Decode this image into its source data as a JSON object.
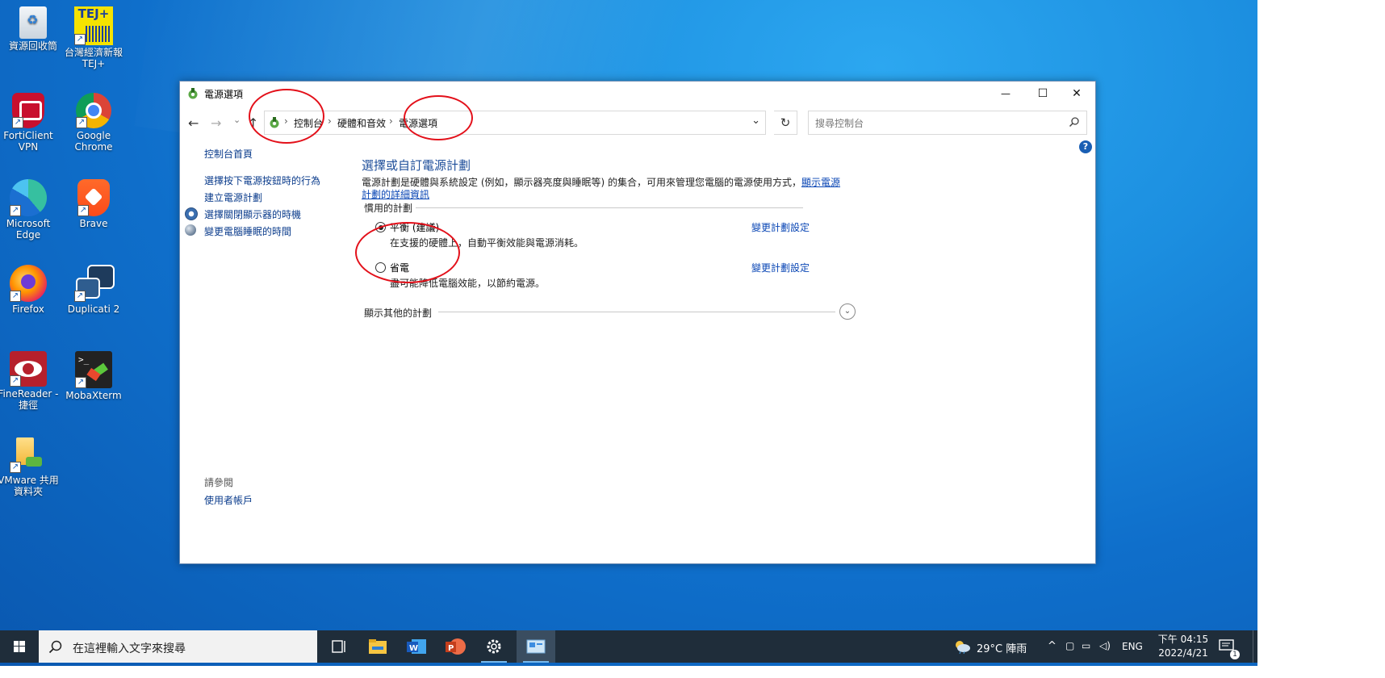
{
  "desktop_icons": [
    {
      "label": "資源回收筒"
    },
    {
      "label": "台灣經濟新報 TEJ+",
      "badge": "TEJ+"
    },
    {
      "label": "FortiClient VPN"
    },
    {
      "label": "Google Chrome"
    },
    {
      "label": "Microsoft Edge"
    },
    {
      "label": "Brave"
    },
    {
      "label": "Firefox"
    },
    {
      "label": "Duplicati 2"
    },
    {
      "label": "FineReader - 捷徑"
    },
    {
      "label": "MobaXterm"
    },
    {
      "label": "VMware 共用資料夾"
    }
  ],
  "window": {
    "title": "電源選項",
    "controls": {
      "minimize": "—",
      "maximize": "☐",
      "close": "✕"
    },
    "nav": {
      "back": "←",
      "forward": "→",
      "recent": "⌄",
      "up": "↑"
    },
    "breadcrumb": [
      "控制台",
      "硬體和音效",
      "電源選項"
    ],
    "breadcrumb_dropdown": "⌄",
    "refresh": "↻",
    "search_placeholder": "搜尋控制台",
    "help": "?"
  },
  "sidebar": {
    "home": "控制台首頁",
    "links": [
      "選擇按下電源按鈕時的行為",
      "建立電源計劃",
      "選擇關閉顯示器的時機",
      "變更電腦睡眠的時間"
    ],
    "see_also_header": "請參閱",
    "see_also": [
      "使用者帳戶"
    ]
  },
  "main": {
    "title": "選擇或自訂電源計劃",
    "description": "電源計劃是硬體與系統設定 (例如，顯示器亮度與睡眠等) 的集合，可用來管理您電腦的電源使用方式，",
    "description_link": "顯示電源計劃的詳細資訊",
    "preferred_header": "慣用的計劃",
    "plans": [
      {
        "name": "平衡 (建議)",
        "description": "在支援的硬體上，自動平衡效能與電源消耗。",
        "selected": true,
        "link": "變更計劃設定"
      },
      {
        "name": "省電",
        "description": "盡可能降低電腦效能，以節約電源。",
        "selected": false,
        "link": "變更計劃設定"
      }
    ],
    "more_plans": "顯示其他的計劃",
    "more_plans_icon": "⌄"
  },
  "taskbar": {
    "search_placeholder": "在這裡輸入文字來搜尋",
    "apps": [
      "task-view",
      "file-explorer",
      "word",
      "powerpoint",
      "settings",
      "control-panel"
    ],
    "weather": "29°C  陣雨",
    "language": "ENG",
    "time": "下午 04:15",
    "date": "2022/4/21",
    "notification_count": "1"
  },
  "colors": {
    "accent": "#0078d7",
    "link": "#0b47b5",
    "annotation": "#e3101a",
    "taskbar": "#1f2d3a"
  }
}
